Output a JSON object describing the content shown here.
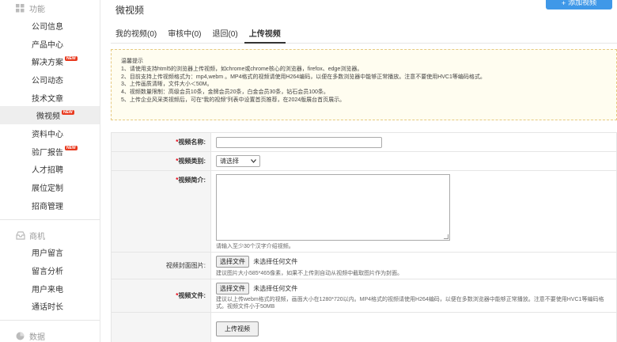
{
  "sidebar": {
    "section1": {
      "label": "功能",
      "icon": "grid-icon"
    },
    "items1": [
      {
        "label": "公司信息",
        "badge": ""
      },
      {
        "label": "产品中心",
        "badge": ""
      },
      {
        "label": "解决方案",
        "badge": "NEW"
      },
      {
        "label": "公司动态",
        "badge": ""
      },
      {
        "label": "技术文章",
        "badge": ""
      },
      {
        "label": "微视频",
        "badge": "NEW"
      },
      {
        "label": "资料中心",
        "badge": ""
      },
      {
        "label": "验厂报告",
        "badge": "NEW"
      },
      {
        "label": "人才招聘",
        "badge": ""
      },
      {
        "label": "展位定制",
        "badge": ""
      },
      {
        "label": "招商管理",
        "badge": ""
      }
    ],
    "section2": {
      "label": "商机",
      "icon": "inbox-icon"
    },
    "items2": [
      {
        "label": "用户留言"
      },
      {
        "label": "留言分析"
      },
      {
        "label": "用户来电"
      },
      {
        "label": "通话时长"
      }
    ],
    "section3": {
      "label": "数据",
      "icon": "pie-icon"
    }
  },
  "main": {
    "title": "微视频",
    "top_button": "添加视频",
    "tabs": [
      "我的视频(0)",
      "审核中(0)",
      "退回(0)",
      "上传视频"
    ],
    "notice": {
      "title": "温馨提示",
      "lines": [
        "1、请使用支持html5的浏览器上传视频，如chrome或chrome核心的浏览器，firefox、edge浏览器。",
        "2、目前支持上传视频格式为：mp4,webm 。MP4格式的视频请使用H264编码，以便在多数浏览器中能够正常播放。注意不要使用HVC1等编码格式。",
        "3、上传画质清晰，文件大小＜50M。",
        "4、视频数量限制：高级会员10条，金牌会员20条，白金会员30条，钻石会员100条。",
        "5、上传企业风采类视频后，可在“我的视频”列表中设置首页推荐，在2024版展台首页展示。"
      ]
    },
    "form": {
      "name_label": "视频名称:",
      "type_label": "视频类别:",
      "type_selected": "请选择",
      "intro_label": "视频简介:",
      "intro_hint": "请输入至少30个汉字介绍视频。",
      "cover_label": "视频封面图片:",
      "choose_file": "选择文件",
      "no_file": "未选择任何文件",
      "cover_hint": "建议图片大小585*465像素，如果不上传则自动从视频中截取图片作为封面。",
      "file_label": "视频文件:",
      "file_hint": "建议以上传webm格式的视频，画面大小在1280*720以内。MP4格式的视频请使用H264编码，以便在多数浏览器中能够正常播放。注意不要使用HVC1等编码格式。视频文件小于50MB",
      "submit": "上传视频"
    }
  }
}
